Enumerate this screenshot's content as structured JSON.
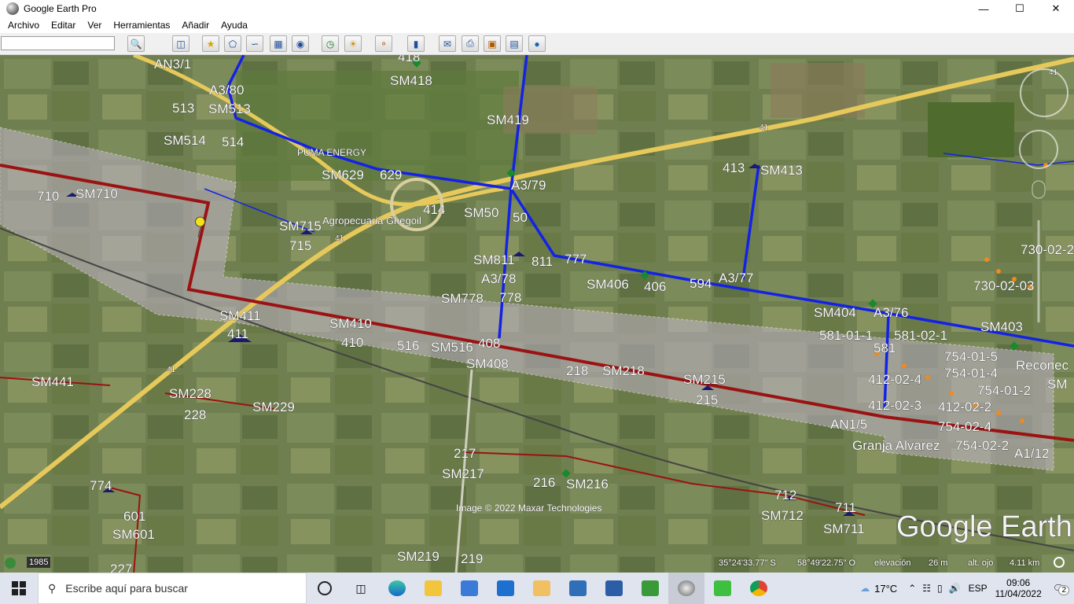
{
  "window": {
    "title": "Google Earth Pro",
    "minimize": "—",
    "maximize": "☐",
    "close": "✕"
  },
  "menu": [
    "Archivo",
    "Editar",
    "Ver",
    "Herramientas",
    "Añadir",
    "Ayuda"
  ],
  "search": {
    "value": "",
    "placeholder": ""
  },
  "toolbar_icons": [
    "search-icon",
    "sidebar-toggle-icon",
    "placemark-icon",
    "polygon-icon",
    "path-icon",
    "overlay-icon",
    "tour-icon",
    "historical-imagery-icon",
    "sunlight-icon",
    "planets-icon",
    "ruler-icon",
    "email-icon",
    "print-icon",
    "save-image-icon",
    "map-view-icon",
    "earth-icon"
  ],
  "map": {
    "labels": [
      {
        "t": "AN3/1"
      },
      {
        "t": "418"
      },
      {
        "t": "SM418"
      },
      {
        "t": "A3/80"
      },
      {
        "t": "513"
      },
      {
        "t": "SM513"
      },
      {
        "t": "SM514"
      },
      {
        "t": "514"
      },
      {
        "t": "SM419"
      },
      {
        "t": "PUMA ENERGY"
      },
      {
        "t": "SM629"
      },
      {
        "t": "629"
      },
      {
        "t": "A3/79"
      },
      {
        "t": "413"
      },
      {
        "t": "SM413"
      },
      {
        "t": "710"
      },
      {
        "t": "SM710"
      },
      {
        "t": "414"
      },
      {
        "t": "SM50"
      },
      {
        "t": "50"
      },
      {
        "t": "Agropecuaria Ghegoil"
      },
      {
        "t": "SM715"
      },
      {
        "t": "715"
      },
      {
        "t": "SM811"
      },
      {
        "t": "811"
      },
      {
        "t": "777"
      },
      {
        "t": "730-02-2"
      },
      {
        "t": "730-02-03"
      },
      {
        "t": "A3/78"
      },
      {
        "t": "SM406"
      },
      {
        "t": "406"
      },
      {
        "t": "594"
      },
      {
        "t": "A3/77"
      },
      {
        "t": "SM778"
      },
      {
        "t": "778"
      },
      {
        "t": "SM404"
      },
      {
        "t": "A3/76"
      },
      {
        "t": "SM403"
      },
      {
        "t": "SM411"
      },
      {
        "t": "411"
      },
      {
        "t": "SM410"
      },
      {
        "t": "410"
      },
      {
        "t": "516"
      },
      {
        "t": "SM516"
      },
      {
        "t": "408"
      },
      {
        "t": "SM408"
      },
      {
        "t": "581-01-1"
      },
      {
        "t": "581-02-1"
      },
      {
        "t": "581"
      },
      {
        "t": "754-01-5"
      },
      {
        "t": "754-01-4"
      },
      {
        "t": "Reconec"
      },
      {
        "t": "218"
      },
      {
        "t": "SM218"
      },
      {
        "t": "SM215"
      },
      {
        "t": "215"
      },
      {
        "t": "412-02-4"
      },
      {
        "t": "754-01-2"
      },
      {
        "t": "SM"
      },
      {
        "t": "SM441"
      },
      {
        "t": "SM228"
      },
      {
        "t": "228"
      },
      {
        "t": "SM229"
      },
      {
        "t": "412-02-3"
      },
      {
        "t": "412-02-2"
      },
      {
        "t": "AN1/5"
      },
      {
        "t": "754-02-4"
      },
      {
        "t": "Granja Alvarez"
      },
      {
        "t": "754-02-2"
      },
      {
        "t": "A1/12"
      },
      {
        "t": "217"
      },
      {
        "t": "SM217"
      },
      {
        "t": "216"
      },
      {
        "t": "SM216"
      },
      {
        "t": "774"
      },
      {
        "t": "601"
      },
      {
        "t": "SM601"
      },
      {
        "t": "712"
      },
      {
        "t": "SM712"
      },
      {
        "t": "711"
      },
      {
        "t": "SM711"
      },
      {
        "t": "SM219"
      },
      {
        "t": "219"
      },
      {
        "t": "227"
      },
      {
        "t": "41"
      },
      {
        "t": "41"
      },
      {
        "t": "41"
      },
      {
        "t": "41"
      }
    ],
    "copyright": "Image © 2022 Maxar Technologies",
    "brand": "Google Earth"
  },
  "status": {
    "year": "1985",
    "lat": "35°24'33.77\" S",
    "lon": "58°49'22.75\" O",
    "elev_label": "elevación",
    "elev_value": "26 m",
    "eye_label": "alt. ojo",
    "eye_value": "4.11 km"
  },
  "taskbar": {
    "search_placeholder": "Escribe aquí para buscar",
    "weather": "17°C",
    "lang": "ESP",
    "time": "09:06",
    "date": "11/04/2022",
    "notifications": "2"
  }
}
